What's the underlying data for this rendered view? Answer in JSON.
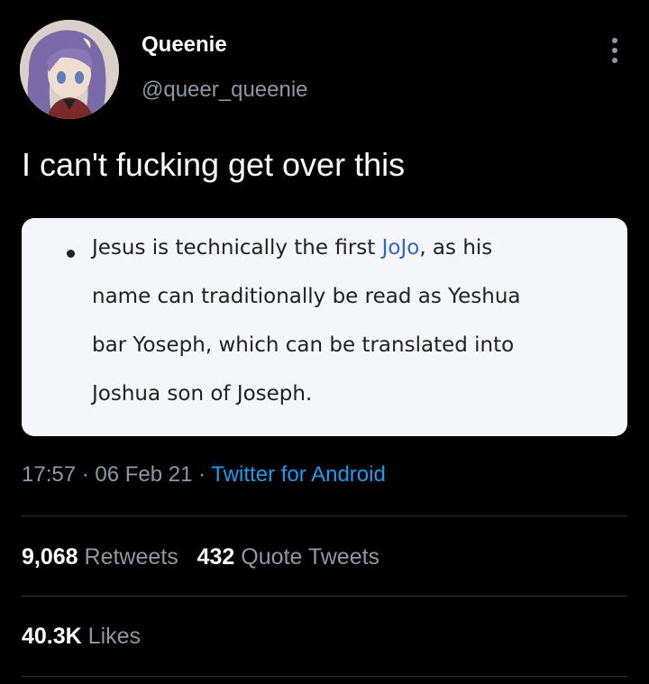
{
  "user": {
    "display_name": "Queenie",
    "handle": "@queer_queenie",
    "avatar_icon": "anime-avatar-icon"
  },
  "tweet": {
    "text": "I can't fucking get over this"
  },
  "quote": {
    "line1_before": "Jesus is technically the first ",
    "line1_link": "JoJo",
    "line1_after": ", as his",
    "line2": "name can traditionally be read as Yeshua",
    "line3": "bar Yoseph, which can be translated into",
    "line4": "Joshua son of Joseph."
  },
  "meta": {
    "time": "17:57",
    "sep1": " · ",
    "date": "06 Feb 21",
    "sep2": " · ",
    "source": "Twitter for Android"
  },
  "stats": {
    "retweets_count": "9,068",
    "retweets_label": "Retweets",
    "quotes_count": "432",
    "quotes_label": "Quote Tweets",
    "likes_count": "40.3K",
    "likes_label": "Likes"
  },
  "colors": {
    "background": "#000000",
    "muted_text": "#8b98a5",
    "link_blue": "#1d9bf0",
    "wiki_link": "#3366cc",
    "card_bg": "#f4f6f9"
  }
}
